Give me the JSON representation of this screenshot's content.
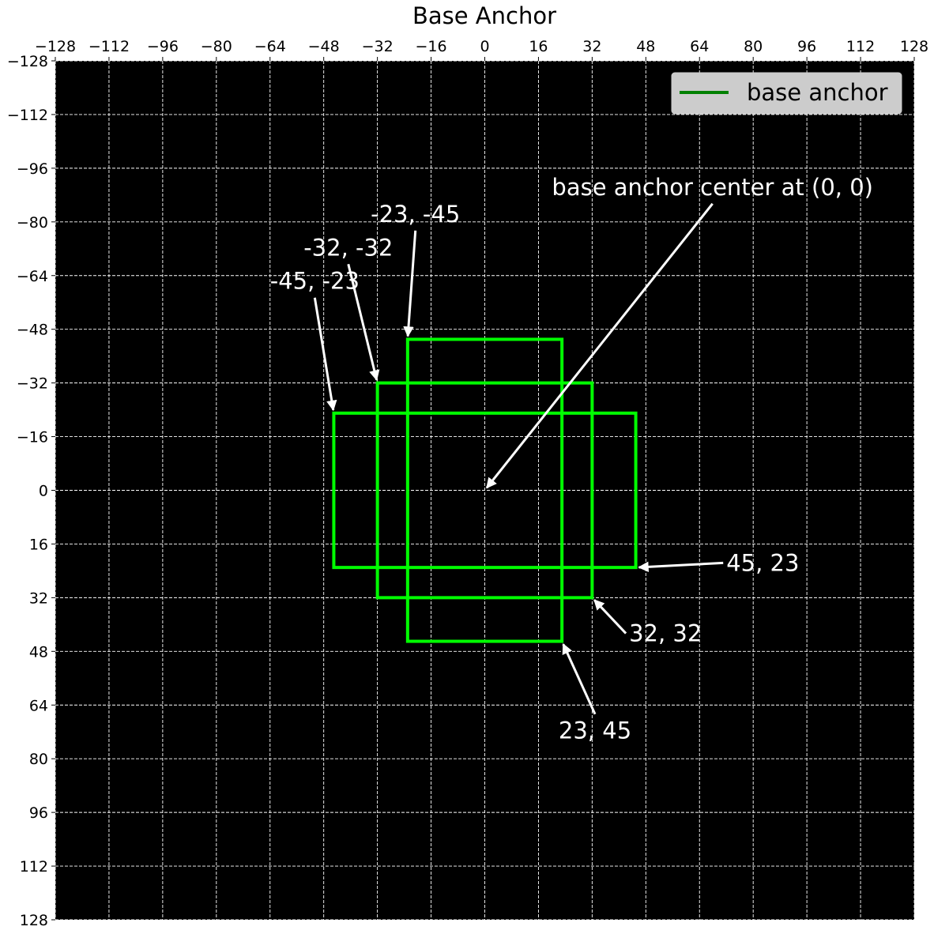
{
  "chart_data": {
    "type": "line",
    "title": "Base Anchor",
    "xlabel": "",
    "ylabel": "",
    "xlim": [
      -128,
      128
    ],
    "ylim": [
      128,
      -128
    ],
    "y_inverted": true,
    "x_axis_position": "top",
    "xticks": [
      -128,
      -112,
      -96,
      -80,
      -64,
      -48,
      -32,
      -16,
      0,
      16,
      32,
      48,
      64,
      80,
      96,
      112,
      128
    ],
    "yticks": [
      -128,
      -112,
      -96,
      -80,
      -64,
      -48,
      -32,
      -16,
      0,
      16,
      32,
      48,
      64,
      80,
      96,
      112,
      128
    ],
    "xtick_labels": [
      "−128",
      "−112",
      "−96",
      "−80",
      "−64",
      "−48",
      "−32",
      "−16",
      "0",
      "16",
      "32",
      "48",
      "64",
      "80",
      "96",
      "112",
      "128"
    ],
    "ytick_labels": [
      "−128",
      "−112",
      "−96",
      "−80",
      "−64",
      "−48",
      "−32",
      "−16",
      "0",
      "16",
      "32",
      "48",
      "64",
      "80",
      "96",
      "112",
      "128"
    ],
    "grid": true,
    "background_color": "#000000",
    "grid_color": "#ffffff",
    "box_color": "#00ff00",
    "legend": {
      "placement": "top-right",
      "entries": [
        {
          "label": "base anchor",
          "color": "#008000"
        }
      ]
    },
    "boxes": [
      {
        "x0": -23,
        "y0": -45,
        "x1": 23,
        "y1": 45
      },
      {
        "x0": -32,
        "y0": -32,
        "x1": 32,
        "y1": 32
      },
      {
        "x0": -45,
        "y0": -23,
        "x1": 45,
        "y1": 23
      }
    ],
    "annotations": [
      {
        "text": "-23, -45",
        "point": [
          -23,
          -45
        ],
        "text_at": [
          -34,
          -80
        ]
      },
      {
        "text": "-32, -32",
        "point": [
          -32,
          -32
        ],
        "text_at": [
          -54,
          -70
        ]
      },
      {
        "text": "-45, -23",
        "point": [
          -45,
          -23
        ],
        "text_at": [
          -64,
          -60
        ]
      },
      {
        "text": "base anchor center at (0, 0)",
        "point": [
          0,
          0
        ],
        "text_at": [
          20,
          -88
        ]
      },
      {
        "text": "45, 23",
        "point": [
          45,
          23
        ],
        "text_at": [
          72,
          24
        ]
      },
      {
        "text": "32, 32",
        "point": [
          32,
          32
        ],
        "text_at": [
          43,
          45
        ]
      },
      {
        "text": "23, 45",
        "point": [
          23,
          45
        ],
        "text_at": [
          22,
          74
        ]
      }
    ]
  }
}
